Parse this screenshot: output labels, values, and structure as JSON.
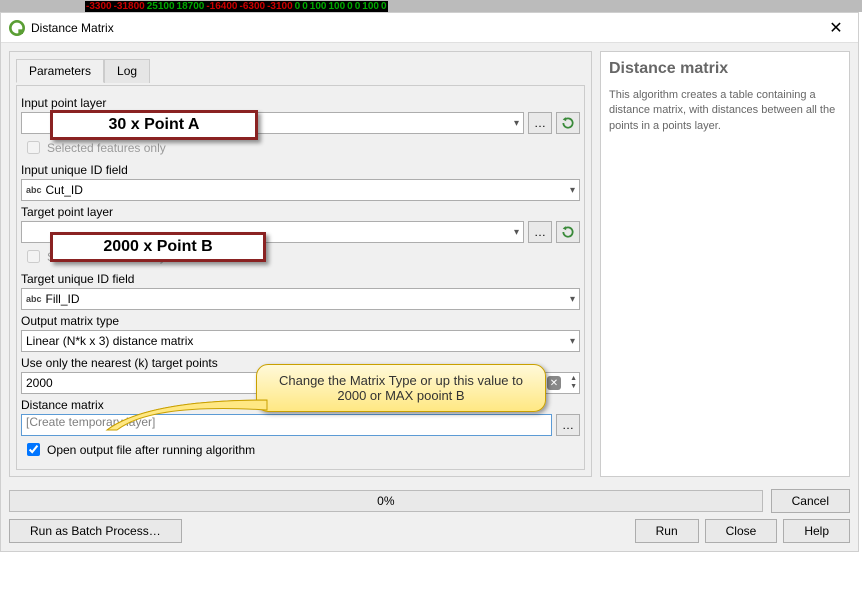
{
  "strip": [
    "-3300",
    "-31800",
    "25100",
    "18700",
    "-16400",
    "-6300",
    "-3100",
    "0",
    "0",
    "100",
    "100",
    "0",
    "0",
    "100",
    "0"
  ],
  "strip_colors": [
    "#c00",
    "#c00",
    "#0a0",
    "#0a0",
    "#c00",
    "#c00",
    "#c00",
    "#0a0",
    "#0a0",
    "#0a0",
    "#0a0",
    "#0a0",
    "#0a0",
    "#0a0",
    "#0a0"
  ],
  "window": {
    "title": "Distance Matrix"
  },
  "tabs": {
    "parameters": "Parameters",
    "log": "Log"
  },
  "labels": {
    "input_layer": "Input point layer",
    "selected_only": "Selected features only",
    "input_id": "Input unique ID field",
    "target_layer": "Target point layer",
    "target_id": "Target unique ID field",
    "matrix_type": "Output matrix type",
    "nearest_k": "Use only the nearest (k) target points",
    "distance_matrix": "Distance matrix",
    "open_output": "Open output file after running algorithm"
  },
  "values": {
    "input_id": "Cut_ID",
    "target_id": "Fill_ID",
    "matrix_type": "Linear (N*k x 3) distance matrix",
    "nearest_k": "2000",
    "distance_matrix_placeholder": "[Create temporary layer]",
    "open_output_checked": true
  },
  "annotations": {
    "red1": "30 x Point A",
    "red2": "2000 x Point B",
    "callout": "Change the Matrix Type or up this value to 2000 or MAX pooint B"
  },
  "right_panel": {
    "heading": "Distance matrix",
    "desc": "This algorithm creates a table containing a distance matrix, with distances between all the points in a points layer."
  },
  "bottom": {
    "progress": "0%",
    "cancel": "Cancel",
    "batch": "Run as Batch Process…",
    "run": "Run",
    "close": "Close",
    "help": "Help"
  }
}
